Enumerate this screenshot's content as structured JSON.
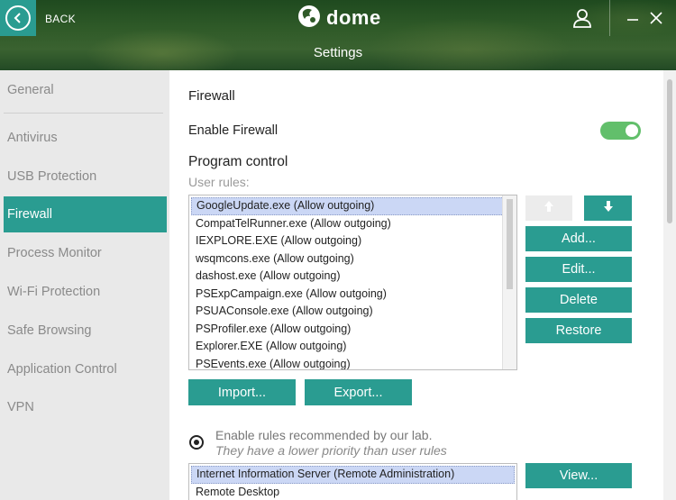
{
  "header": {
    "back_label": "BACK",
    "logo_text": "dome",
    "title": "Settings"
  },
  "sidebar": {
    "items": [
      {
        "label": "General",
        "active": false
      },
      {
        "label": "Antivirus",
        "active": false
      },
      {
        "label": "USB Protection",
        "active": false
      },
      {
        "label": "Firewall",
        "active": true
      },
      {
        "label": "Process Monitor",
        "active": false
      },
      {
        "label": "Wi-Fi Protection",
        "active": false
      },
      {
        "label": "Safe Browsing",
        "active": false
      },
      {
        "label": "Application Control",
        "active": false
      },
      {
        "label": "VPN",
        "active": false
      }
    ]
  },
  "main": {
    "section_title": "Firewall",
    "enable_firewall_label": "Enable Firewall",
    "enable_firewall_on": true,
    "program_control_label": "Program control",
    "user_rules_label": "User rules:",
    "user_rules": [
      "GoogleUpdate.exe (Allow outgoing)",
      "CompatTelRunner.exe (Allow outgoing)",
      "IEXPLORE.EXE (Allow outgoing)",
      "wsqmcons.exe (Allow outgoing)",
      "dashost.exe (Allow outgoing)",
      "PSExpCampaign.exe (Allow outgoing)",
      "PSUAConsole.exe (Allow outgoing)",
      "PSProfiler.exe (Allow outgoing)",
      "Explorer.EXE (Allow outgoing)",
      "PSEvents.exe (Allow outgoing)"
    ],
    "buttons": {
      "add": "Add...",
      "edit": "Edit...",
      "delete": "Delete",
      "restore": "Restore",
      "import": "Import...",
      "export": "Export...",
      "view": "View..."
    },
    "recommended_label": "Enable rules recommended by our lab.",
    "recommended_sub": "They have a lower priority than user rules",
    "recommended_rules": [
      "Internet Information Server (Remote Administration)",
      "Remote Desktop"
    ]
  },
  "colors": {
    "accent": "#2a9c91",
    "toggle_on": "#62bf6b",
    "selection": "#cbd7f5"
  }
}
